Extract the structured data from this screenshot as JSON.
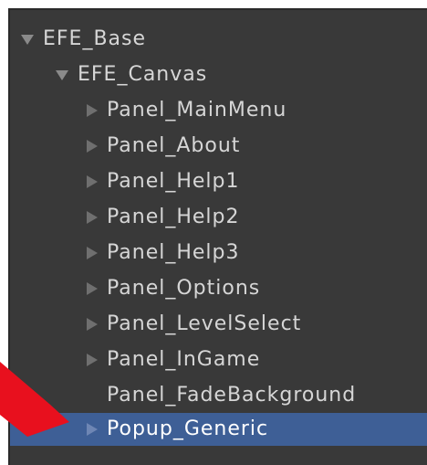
{
  "hierarchy": {
    "items": [
      {
        "label": "EFE_Base",
        "depth": 0,
        "expanded": true,
        "has_children": true,
        "selected": false
      },
      {
        "label": "EFE_Canvas",
        "depth": 1,
        "expanded": true,
        "has_children": true,
        "selected": false
      },
      {
        "label": "Panel_MainMenu",
        "depth": 2,
        "expanded": false,
        "has_children": true,
        "selected": false
      },
      {
        "label": "Panel_About",
        "depth": 2,
        "expanded": false,
        "has_children": true,
        "selected": false
      },
      {
        "label": "Panel_Help1",
        "depth": 2,
        "expanded": false,
        "has_children": true,
        "selected": false
      },
      {
        "label": "Panel_Help2",
        "depth": 2,
        "expanded": false,
        "has_children": true,
        "selected": false
      },
      {
        "label": "Panel_Help3",
        "depth": 2,
        "expanded": false,
        "has_children": true,
        "selected": false
      },
      {
        "label": "Panel_Options",
        "depth": 2,
        "expanded": false,
        "has_children": true,
        "selected": false
      },
      {
        "label": "Panel_LevelSelect",
        "depth": 2,
        "expanded": false,
        "has_children": true,
        "selected": false
      },
      {
        "label": "Panel_InGame",
        "depth": 2,
        "expanded": false,
        "has_children": true,
        "selected": false
      },
      {
        "label": "Panel_FadeBackground",
        "depth": 2,
        "expanded": false,
        "has_children": false,
        "selected": false
      },
      {
        "label": "Popup_Generic",
        "depth": 2,
        "expanded": false,
        "has_children": true,
        "selected": true
      }
    ]
  },
  "colors": {
    "panel_background": "#393939",
    "selection": "#3e5f96",
    "text": "#d6d6d6",
    "annotation_arrow": "#e8101e"
  },
  "annotation": {
    "icon": "red-pointer-arrow-icon"
  }
}
